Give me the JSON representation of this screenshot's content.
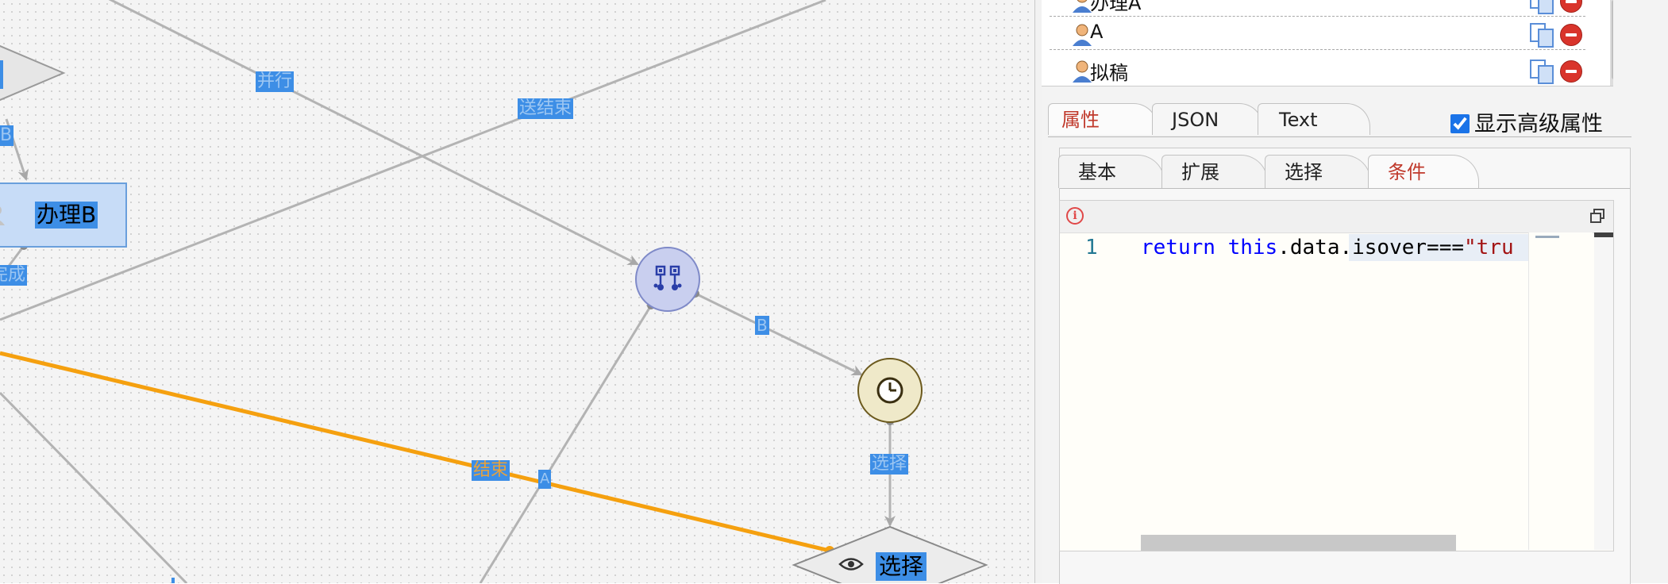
{
  "diagram": {
    "edge_labels": {
      "parallel": "并行",
      "send_end": "送结束",
      "handle_b_partial": "办理B",
      "complete_partial": "完成",
      "b": "B",
      "end": "结束",
      "a": "A",
      "select": "选择"
    },
    "task_node": {
      "label": "办理B"
    },
    "gateway_node": {
      "label": "选择"
    },
    "colors": {
      "selected_edge": "#f5a00f",
      "edge": "#b3b3b3",
      "label_bg": "#3d8ee6"
    }
  },
  "panel": {
    "users": [
      {
        "name": "办理A"
      },
      {
        "name": "A"
      },
      {
        "name": "拟稿"
      }
    ],
    "main_tabs": [
      {
        "label": "属性",
        "active": true
      },
      {
        "label": "JSON",
        "active": false
      },
      {
        "label": "Text",
        "active": false
      }
    ],
    "advanced_checkbox": {
      "label": "显示高级属性",
      "checked": true
    },
    "sub_tabs": [
      {
        "label": "基本",
        "active": false
      },
      {
        "label": "扩展",
        "active": false
      },
      {
        "label": "选择",
        "active": false
      },
      {
        "label": "条件",
        "active": true
      }
    ],
    "editor": {
      "line_number": "1",
      "code_keyword_return": "return",
      "code_keyword_this": "this",
      "code_member": ".data.isover===",
      "code_string": "\"tru"
    }
  }
}
